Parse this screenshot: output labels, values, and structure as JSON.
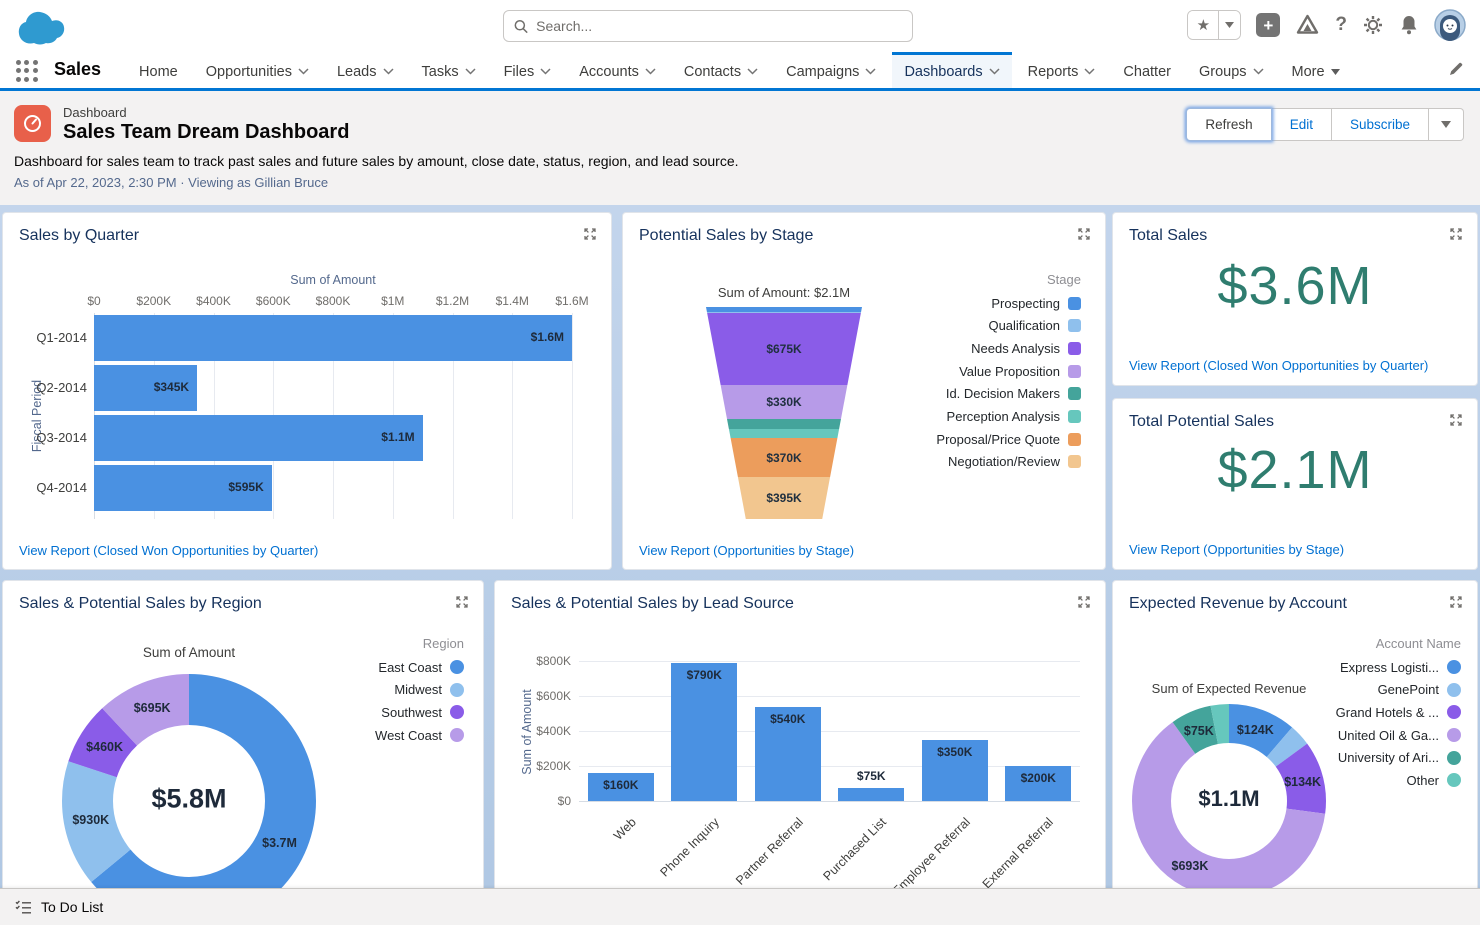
{
  "topbar": {
    "search_placeholder": "Search..."
  },
  "nav": {
    "app_name": "Sales",
    "tabs": [
      {
        "label": "Home"
      },
      {
        "label": "Opportunities",
        "chevron": true
      },
      {
        "label": "Leads",
        "chevron": true
      },
      {
        "label": "Tasks",
        "chevron": true
      },
      {
        "label": "Files",
        "chevron": true
      },
      {
        "label": "Accounts",
        "chevron": true
      },
      {
        "label": "Contacts",
        "chevron": true
      },
      {
        "label": "Campaigns",
        "chevron": true
      },
      {
        "label": "Dashboards",
        "chevron": true,
        "active": true
      },
      {
        "label": "Reports",
        "chevron": true
      },
      {
        "label": "Chatter"
      },
      {
        "label": "Groups",
        "chevron": true
      },
      {
        "label": "More",
        "caret": true
      }
    ]
  },
  "header": {
    "eyebrow": "Dashboard",
    "title": "Sales Team Dream Dashboard",
    "description": "Dashboard for sales team to track past sales and future sales by amount, close date, status, region, and lead source.",
    "as_of": "As of Apr 22, 2023, 2:30 PM · Viewing as Gillian Bruce",
    "buttons": {
      "refresh": "Refresh",
      "edit": "Edit",
      "subscribe": "Subscribe"
    }
  },
  "footer": {
    "todo_label": "To Do List"
  },
  "colors": {
    "accent": "#0176d3",
    "link": "#0070d2",
    "metric_teal": "#2f7d6f",
    "chart_blue": "#4a91e2"
  },
  "chart_data": [
    {
      "type": "bar",
      "orientation": "horizontal",
      "title": "Sales by Quarter",
      "axis_title": "Sum of Amount",
      "ylabel": "Fiscal Period",
      "categories": [
        "Q1-2014",
        "Q2-2014",
        "Q3-2014",
        "Q4-2014"
      ],
      "values": [
        1600000,
        345000,
        1100000,
        595000
      ],
      "labels": [
        "$1.6M",
        "$345K",
        "$1.1M",
        "$595K"
      ],
      "xlim": [
        0,
        1600000
      ],
      "xticks": [
        "$0",
        "$200K",
        "$400K",
        "$600K",
        "$800K",
        "$1M",
        "$1.2M",
        "$1.4M",
        "$1.6M"
      ],
      "bar_color": "#4a91e2",
      "view_report": "View Report (Closed Won Opportunities by Quarter)"
    },
    {
      "type": "funnel",
      "title": "Potential Sales by Stage",
      "subtitle": "Sum of Amount: $2.1M",
      "legend_title": "Stage",
      "stages": [
        {
          "label": "Prospecting",
          "color": "#4a91e2",
          "value": 45000,
          "display": ""
        },
        {
          "label": "Qualification",
          "color": "#8fc0ed",
          "value": 15000,
          "display": ""
        },
        {
          "label": "Needs Analysis",
          "color": "#8a5ce8",
          "value": 675000,
          "display": "$675K"
        },
        {
          "label": "Value Proposition",
          "color": "#b79be8",
          "value": 330000,
          "display": "$330K"
        },
        {
          "label": "Id. Decision Makers",
          "color": "#44a49b",
          "value": 90000,
          "display": ""
        },
        {
          "label": "Perception Analysis",
          "color": "#66c7bd",
          "value": 90000,
          "display": ""
        },
        {
          "label": "Proposal/Price Quote",
          "color": "#ec9d5c",
          "value": 370000,
          "display": "$370K"
        },
        {
          "label": "Negotiation/Review",
          "color": "#f2c68f",
          "value": 395000,
          "display": "$395K"
        }
      ],
      "view_report": "View Report (Opportunities by Stage)"
    },
    {
      "type": "metric",
      "title": "Total Sales",
      "value": "$3.6M",
      "view_report": "View Report (Closed Won Opportunities by Quarter)"
    },
    {
      "type": "metric",
      "title": "Total Potential Sales",
      "value": "$2.1M",
      "view_report": "View Report (Opportunities by Stage)"
    },
    {
      "type": "donut",
      "title": "Sales & Potential Sales by Region",
      "chart_title": "Sum of Amount",
      "legend_title": "Region",
      "center_label": "$5.8M",
      "slices": [
        {
          "label": "East Coast",
          "color": "#4a91e2",
          "value": 3700000,
          "display": "$3.7M"
        },
        {
          "label": "Midwest",
          "color": "#8fc0ed",
          "value": 930000,
          "display": "$930K"
        },
        {
          "label": "Southwest",
          "color": "#8a5ce8",
          "value": 460000,
          "display": "$460K"
        },
        {
          "label": "West Coast",
          "color": "#b79be8",
          "value": 695000,
          "display": "$695K"
        }
      ]
    },
    {
      "type": "bar",
      "orientation": "vertical",
      "title": "Sales & Potential Sales by Lead Source",
      "ylabel": "Sum of Amount",
      "categories": [
        "Web",
        "Phone Inquiry",
        "Partner Referral",
        "Purchased List",
        "Employee Referral",
        "External Referral"
      ],
      "values": [
        160000,
        790000,
        540000,
        75000,
        350000,
        200000
      ],
      "labels": [
        "$160K",
        "$790K",
        "$540K",
        "$75K",
        "$350K",
        "$200K"
      ],
      "ylim": [
        0,
        800000
      ],
      "yticks": [
        "$0",
        "$200K",
        "$400K",
        "$600K",
        "$800K"
      ],
      "bar_color": "#4a91e2"
    },
    {
      "type": "donut",
      "title": "Expected Revenue by Account",
      "chart_title": "Sum of Expected Revenue",
      "legend_title": "Account Name",
      "center_label": "$1.1M",
      "slices": [
        {
          "label": "Express Logisti...",
          "color": "#4a91e2",
          "value": 124000,
          "display": "$124K"
        },
        {
          "label": "GenePoint",
          "color": "#8fc0ed",
          "value": 40000,
          "display": ""
        },
        {
          "label": "Grand Hotels & ...",
          "color": "#8a5ce8",
          "value": 134000,
          "display": "$134K"
        },
        {
          "label": "United Oil & Ga...",
          "color": "#b79be8",
          "value": 693000,
          "display": "$693K"
        },
        {
          "label": "University of Ari...",
          "color": "#44a49b",
          "value": 75000,
          "display": "$75K"
        },
        {
          "label": "Other",
          "color": "#66c7bd",
          "value": 34000,
          "display": ""
        }
      ]
    }
  ]
}
